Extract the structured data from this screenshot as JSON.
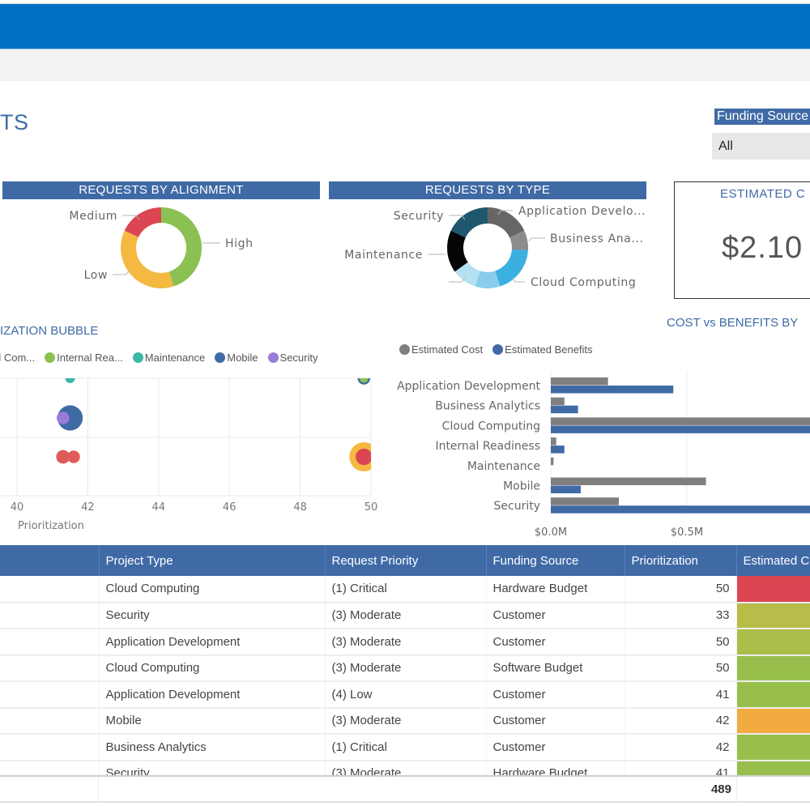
{
  "header": {
    "page_title": "TS",
    "brand_color": "#0070c4",
    "accent_color": "#3f6aa6"
  },
  "slicer": {
    "label": "Funding Source",
    "value": "All"
  },
  "panels": {
    "alignment_title": "REQUESTS BY ALIGNMENT",
    "type_title": "REQUESTS BY TYPE",
    "bubble_title": "IZATION BUBBLE",
    "bar_title": "COST vs BENEFITS BY"
  },
  "kpi": {
    "title": "ESTIMATED C",
    "value": "$2.10"
  },
  "chart_data": [
    {
      "type": "pie",
      "title": "REQUESTS BY ALIGNMENT",
      "donut": true,
      "labels": [
        "High",
        "Low",
        "Medium"
      ],
      "values": [
        45,
        37,
        18
      ],
      "colors": [
        "#8bc152",
        "#f5b942",
        "#dc4652"
      ]
    },
    {
      "type": "pie",
      "title": "REQUESTS BY TYPE",
      "donut": true,
      "labels": [
        "Application Develo...",
        "Business Ana...",
        "Cloud Computing",
        "Maintenance",
        "Mobile",
        "Security"
      ],
      "label_full": [
        "Application Development",
        "Business Analytics",
        "Cloud Computing",
        "Internal Readiness",
        "Maintenance",
        "Mobile",
        "Security"
      ],
      "slices": [
        {
          "label": "Application Develo...",
          "value": 18,
          "color": "#666666"
        },
        {
          "label": "Business Ana...",
          "value": 8,
          "color": "#8c8c8c"
        },
        {
          "label": "Cloud Computing",
          "value": 19,
          "color": "#3bafe0"
        },
        {
          "label": "",
          "value": 10,
          "color": "#88cdeb"
        },
        {
          "label": "Maintenance",
          "value": 10,
          "color": "#b5e0f2"
        },
        {
          "label": "Mobile",
          "value": 17,
          "color": "#050505"
        },
        {
          "label": "Security",
          "value": 18,
          "color": "#1f586e"
        }
      ]
    },
    {
      "type": "scatter",
      "title": "PRIORITIZATION BUBBLE",
      "xlabel": "Prioritization",
      "x_ticks": [
        "40",
        "42",
        "44",
        "46",
        "48",
        "50"
      ],
      "xlim": [
        40,
        50
      ],
      "legend": [
        {
          "label": "d Com...",
          "color": "#f5b942"
        },
        {
          "label": "Internal Rea...",
          "color": "#8bc152"
        },
        {
          "label": "Maintenance",
          "color": "#3bb8a6"
        },
        {
          "label": "Mobile",
          "color": "#3f6aa6"
        },
        {
          "label": "Security",
          "color": "#9b7ad8"
        }
      ],
      "points": [
        {
          "series": "Maintenance",
          "x": 41.5,
          "row": 0,
          "size": 1,
          "color": "#3bb8a6"
        },
        {
          "series": "Mobile",
          "x": 49.8,
          "row": 0,
          "size": 1.3,
          "color": "#3f6aa6"
        },
        {
          "series": "Internal Rea...",
          "x": 49.8,
          "row": 0,
          "size": 0.9,
          "color": "#8bc152"
        },
        {
          "series": "Mobile",
          "x": 41.5,
          "row": 1,
          "size": 2.6,
          "color": "#3f6aa6"
        },
        {
          "series": "Security",
          "x": 41.3,
          "row": 1,
          "size": 1.3,
          "color": "#9b7ad8"
        },
        {
          "series": "Application Development",
          "x": 41.3,
          "row": 2,
          "size": 1.4,
          "color": "#dc5a5a"
        },
        {
          "series": "Application Development",
          "x": 41.6,
          "row": 2,
          "size": 1.3,
          "color": "#e25b5b"
        },
        {
          "series": "d Com...",
          "x": 49.8,
          "row": 2,
          "size": 3.0,
          "color": "#f5b942"
        },
        {
          "series": "Application Development",
          "x": 49.8,
          "row": 2,
          "size": 1.7,
          "color": "#dc4652"
        }
      ]
    },
    {
      "type": "bar",
      "orientation": "horizontal",
      "title": "COST vs BENEFITS BY",
      "categories": [
        "Application Development",
        "Business Analytics",
        "Cloud Computing",
        "Internal Readiness",
        "Maintenance",
        "Mobile",
        "Security"
      ],
      "series": [
        {
          "name": "Estimated Cost",
          "color": "#7f7f7f",
          "values": [
            0.21,
            0.05,
            1.0,
            0.02,
            0.01,
            0.57,
            0.25
          ]
        },
        {
          "name": "Estimated Benefits",
          "color": "#3f6aa6",
          "values": [
            0.45,
            0.1,
            1.0,
            0.05,
            0.0,
            0.11,
            1.0
          ]
        }
      ],
      "x_ticks": [
        "$0.0M",
        "$0.5M",
        "$"
      ],
      "xlim": [
        0,
        1.0
      ],
      "legend_position": "top-left"
    }
  ],
  "table": {
    "columns": [
      "",
      "Project Type",
      "Request Priority",
      "Funding Source",
      "Prioritization",
      "Estimated C"
    ],
    "rows": [
      {
        "project_type": "Cloud Computing",
        "priority": "(1) Critical",
        "funding": "Hardware Budget",
        "prioritization": "50",
        "estimated_color": "#dc4652"
      },
      {
        "project_type": "Security",
        "priority": "(3) Moderate",
        "funding": "Customer",
        "prioritization": "33",
        "estimated_color": "#b8bc48"
      },
      {
        "project_type": "Application Development",
        "priority": "(3) Moderate",
        "funding": "Customer",
        "prioritization": "50",
        "estimated_color": "#aabe49"
      },
      {
        "project_type": "Cloud Computing",
        "priority": "(3) Moderate",
        "funding": "Software Budget",
        "prioritization": "50",
        "estimated_color": "#98bf4c"
      },
      {
        "project_type": "Application Development",
        "priority": "(4) Low",
        "funding": "Customer",
        "prioritization": "41",
        "estimated_color": "#98bf4c"
      },
      {
        "project_type": "Mobile",
        "priority": "(3) Moderate",
        "funding": "Customer",
        "prioritization": "42",
        "estimated_color": "#f2ab40"
      },
      {
        "project_type": "Business Analytics",
        "priority": "(1) Critical",
        "funding": "Customer",
        "prioritization": "42",
        "estimated_color": "#98bf4c"
      },
      {
        "project_type": "Security",
        "priority": "(3) Moderate",
        "funding": "Hardware Budget",
        "prioritization": "41",
        "estimated_color": "#98bf4c"
      }
    ],
    "total_prioritization": "489"
  }
}
